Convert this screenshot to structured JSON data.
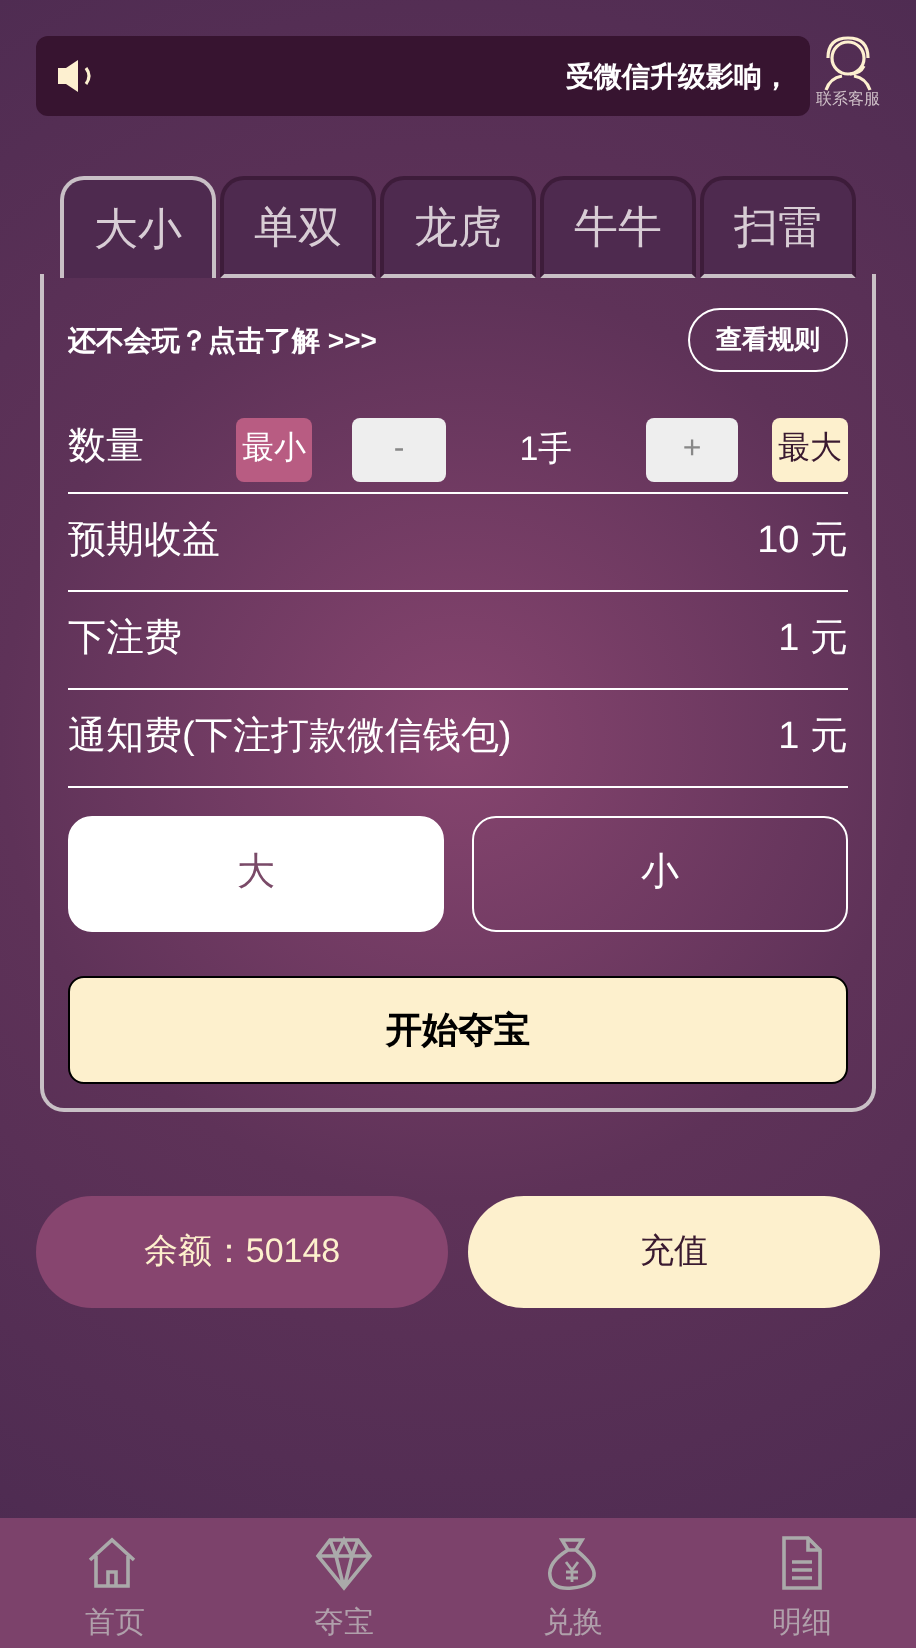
{
  "notice": {
    "text": "受微信升级影响，"
  },
  "support": {
    "label": "联系客服"
  },
  "tabs": [
    {
      "label": "大小",
      "selected": true
    },
    {
      "label": "单双",
      "selected": false
    },
    {
      "label": "龙虎",
      "selected": false
    },
    {
      "label": "牛牛",
      "selected": false
    },
    {
      "label": "扫雷",
      "selected": false
    }
  ],
  "help": {
    "text": "还不会玩？点击了解 >>>",
    "rules_button": "查看规则"
  },
  "quantity": {
    "label": "数量",
    "min": "最小",
    "minus": "-",
    "value": "1手",
    "plus": "+",
    "max": "最大"
  },
  "rows": [
    {
      "label": "预期收益",
      "value": "10 元"
    },
    {
      "label": "下注费",
      "value": "1 元"
    },
    {
      "label": "通知费(下注打款微信钱包)",
      "value": "1 元"
    }
  ],
  "choices": [
    {
      "label": "大",
      "selected": true
    },
    {
      "label": "小",
      "selected": false
    }
  ],
  "start_button": "开始夺宝",
  "balance": "余额：50148",
  "recharge_button": "充值",
  "nav": [
    {
      "label": "首页",
      "kind": "home"
    },
    {
      "label": "夺宝",
      "kind": "treasure"
    },
    {
      "label": "兑换",
      "kind": "exchange"
    },
    {
      "label": "明细",
      "kind": "details"
    }
  ]
}
